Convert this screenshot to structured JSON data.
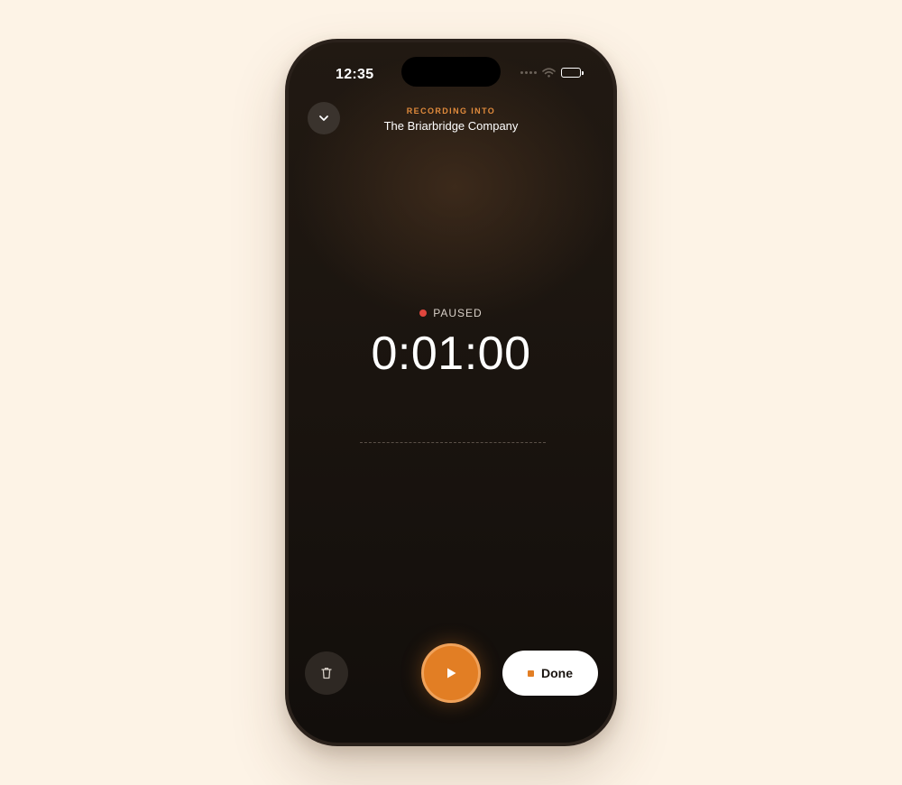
{
  "status_bar": {
    "time": "12:35"
  },
  "header": {
    "eyebrow": "RECORDING INTO",
    "title": "The Briarbridge Company",
    "collapse_icon": "chevron-down-icon"
  },
  "recorder": {
    "state_label": "PAUSED",
    "elapsed": "0:01:00"
  },
  "controls": {
    "delete_icon": "trash-icon",
    "play_icon": "play-icon",
    "done_label": "Done",
    "done_icon": "stop-square-icon"
  },
  "colors": {
    "accent": "#e27e24",
    "accent_text": "#e08a3c",
    "status_dot": "#e0463d",
    "background": "#fdf3e6"
  }
}
